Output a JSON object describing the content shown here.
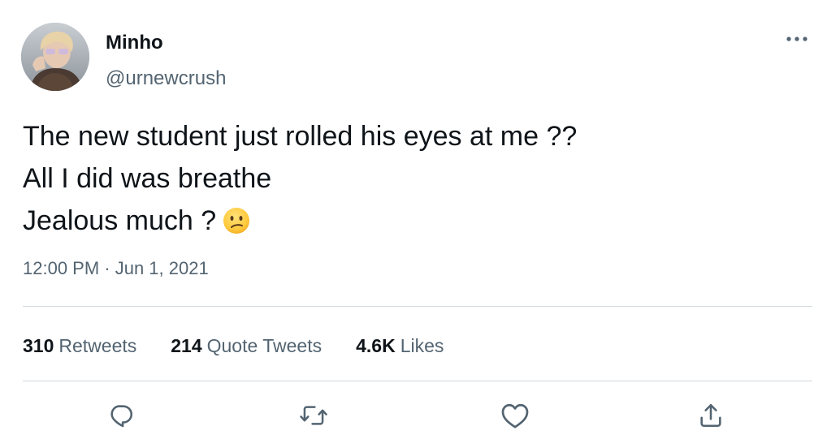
{
  "author": {
    "display_name": "Minho",
    "handle": "@urnewcrush"
  },
  "tweet": {
    "lines": [
      "The new student just rolled his eyes at me ??",
      "All I did was breathe",
      "Jealous much ?"
    ],
    "emoji": "confused-face-emoji",
    "timestamp": "12:00 PM · Jun 1, 2021"
  },
  "stats": {
    "retweets_count": "310",
    "retweets_label": "Retweets",
    "quotes_count": "214",
    "quotes_label": "Quote Tweets",
    "likes_count": "4.6K",
    "likes_label": "Likes"
  },
  "actions": [
    "reply-icon",
    "retweet-icon",
    "like-icon",
    "share-icon"
  ],
  "colors": {
    "text_primary": "#0f1419",
    "text_secondary": "#536471",
    "divider": "#cfd9de",
    "icon": "#536471"
  }
}
